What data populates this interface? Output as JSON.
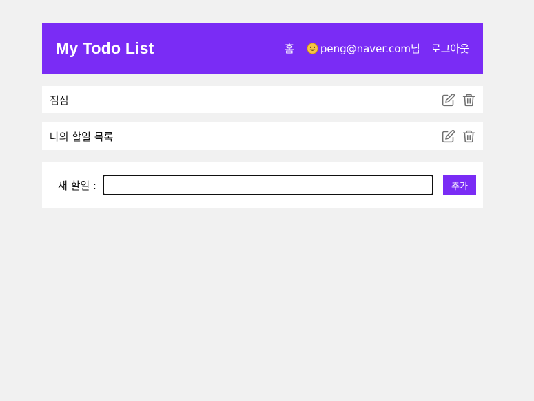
{
  "header": {
    "title": "My Todo List",
    "nav": {
      "home": "홈",
      "user": "peng@naver.com님",
      "logout": "로그아웃"
    },
    "accent_color": "#7a2cf5"
  },
  "todos": [
    {
      "text": "점심",
      "edit_icon": "edit-icon",
      "delete_icon": "trash-icon"
    },
    {
      "text": "나의 할일 목록",
      "edit_icon": "edit-icon",
      "delete_icon": "trash-icon"
    }
  ],
  "add_form": {
    "label": "새 할일 :",
    "value": "",
    "button_label": "추가"
  }
}
